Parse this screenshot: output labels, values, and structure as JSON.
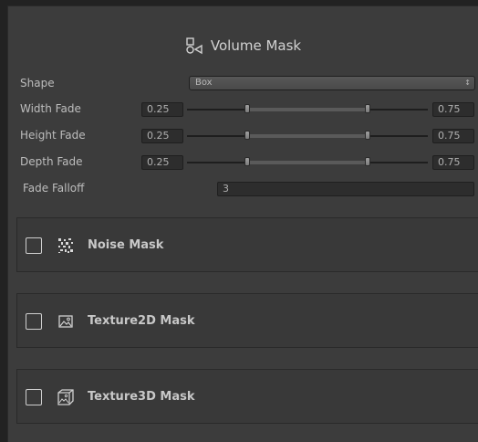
{
  "header": {
    "title": "Volume Mask",
    "icon": "shapes-icon"
  },
  "shape": {
    "label": "Shape",
    "value": "Box"
  },
  "sliders": [
    {
      "label": "Width Fade",
      "min_value": "0.25",
      "max_value": "0.75",
      "range_min": 0.25,
      "range_max": 0.75
    },
    {
      "label": "Height Fade",
      "min_value": "0.25",
      "max_value": "0.75",
      "range_min": 0.25,
      "range_max": 0.75
    },
    {
      "label": "Depth Fade",
      "min_value": "0.25",
      "max_value": "0.75",
      "range_min": 0.25,
      "range_max": 0.75
    }
  ],
  "falloff": {
    "label": "Fade Falloff",
    "value": "3"
  },
  "sections": [
    {
      "title": "Noise Mask",
      "icon": "noise-icon",
      "checked": false
    },
    {
      "title": "Texture2D Mask",
      "icon": "image-icon",
      "checked": false
    },
    {
      "title": "Texture3D Mask",
      "icon": "cube-image-icon",
      "checked": false
    }
  ],
  "colors": {
    "panel": "#3c3c3c",
    "background": "#222222",
    "text": "#c4c4c4"
  }
}
